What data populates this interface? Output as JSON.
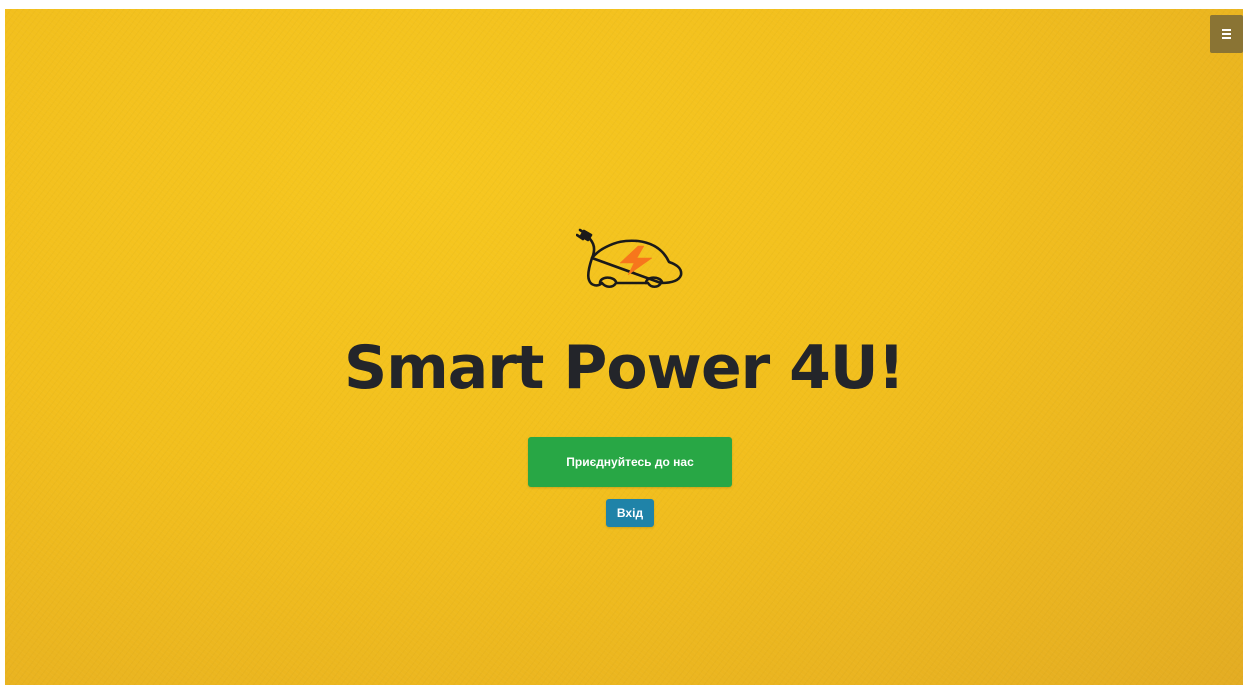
{
  "header": {
    "menu_icon": "hamburger-menu-icon"
  },
  "hero": {
    "logo_icon": "electric-car-plug-icon",
    "title": "Smart Power 4U!",
    "join_button_label": "Приєднуйтесь до нас",
    "login_button_label": "Вхід"
  },
  "colors": {
    "background": "#f2bf1d",
    "title_text": "#23252a",
    "join_button": "#28a745",
    "login_button": "#1f83a8",
    "menu_button": "#8a7434",
    "bolt_accent": "#f7761c"
  }
}
